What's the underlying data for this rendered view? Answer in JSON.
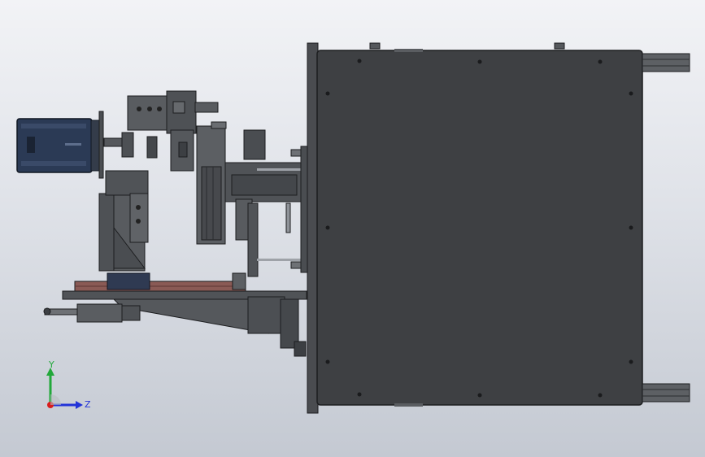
{
  "viewport": {
    "colors": {
      "background_top": "#f2f3f6",
      "background_bottom": "#c4c9d2",
      "body_dark": "#3e4043",
      "edge": "#1c1d1f",
      "frame_mid": "#5a5d61",
      "motor_blue": "#2b3a55",
      "rail_red": "#8a5a55"
    }
  },
  "triad": {
    "y_label": "Y",
    "z_label": "Z",
    "y_color": "#22a83a",
    "z_color": "#2233d8",
    "x_color": "#d81d1d"
  }
}
